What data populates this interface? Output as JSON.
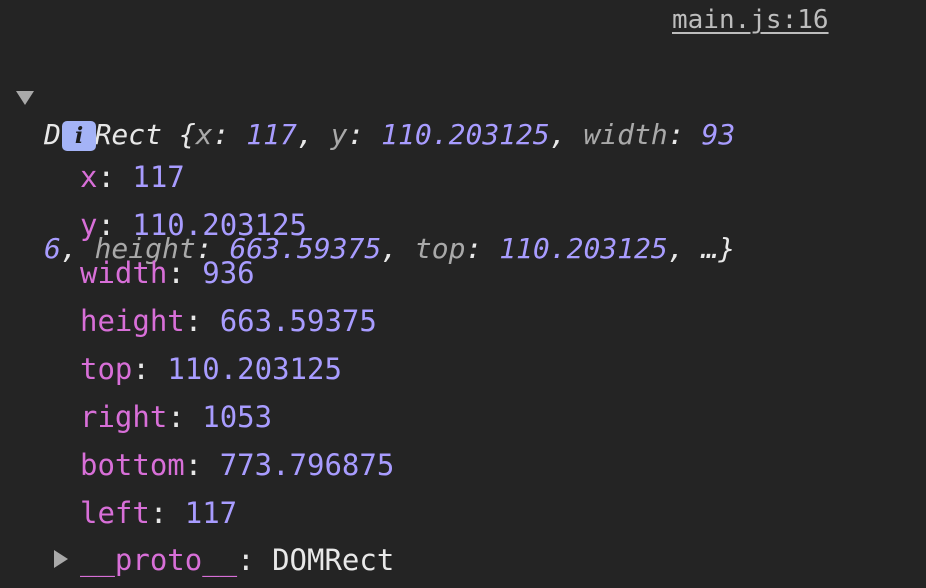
{
  "source_link": "main.js:16",
  "summary": {
    "line1": [
      {
        "t": "DOMRect {",
        "c": "p"
      },
      {
        "t": "x",
        "c": "k"
      },
      {
        "t": ": ",
        "c": "p"
      },
      {
        "t": "117",
        "c": "n"
      },
      {
        "t": ", ",
        "c": "p"
      },
      {
        "t": "y",
        "c": "k"
      },
      {
        "t": ": ",
        "c": "p"
      },
      {
        "t": "110.203125",
        "c": "n"
      },
      {
        "t": ", ",
        "c": "p"
      },
      {
        "t": "width",
        "c": "k"
      },
      {
        "t": ": ",
        "c": "p"
      },
      {
        "t": "93",
        "c": "n"
      }
    ],
    "line2": [
      {
        "t": "6",
        "c": "n"
      },
      {
        "t": ", ",
        "c": "p"
      },
      {
        "t": "height",
        "c": "k"
      },
      {
        "t": ": ",
        "c": "p"
      },
      {
        "t": "663.59375",
        "c": "n"
      },
      {
        "t": ", ",
        "c": "p"
      },
      {
        "t": "top",
        "c": "k"
      },
      {
        "t": ": ",
        "c": "p"
      },
      {
        "t": "110.203125",
        "c": "n"
      },
      {
        "t": ", …}",
        "c": "p"
      }
    ]
  },
  "info_badge": "i",
  "properties": [
    {
      "key": "x",
      "value": "117"
    },
    {
      "key": "y",
      "value": "110.203125"
    },
    {
      "key": "width",
      "value": "936"
    },
    {
      "key": "height",
      "value": "663.59375"
    },
    {
      "key": "top",
      "value": "110.203125"
    },
    {
      "key": "right",
      "value": "1053"
    },
    {
      "key": "bottom",
      "value": "773.796875"
    },
    {
      "key": "left",
      "value": "117"
    }
  ],
  "proto": {
    "key": "__proto__",
    "value": "DOMRect"
  },
  "colors": {
    "background": "#242424",
    "property_key": "#d86fd8",
    "number": "#a89cff",
    "summary_key": "#a9a9a9",
    "info_badge": "#a4b3f6"
  }
}
